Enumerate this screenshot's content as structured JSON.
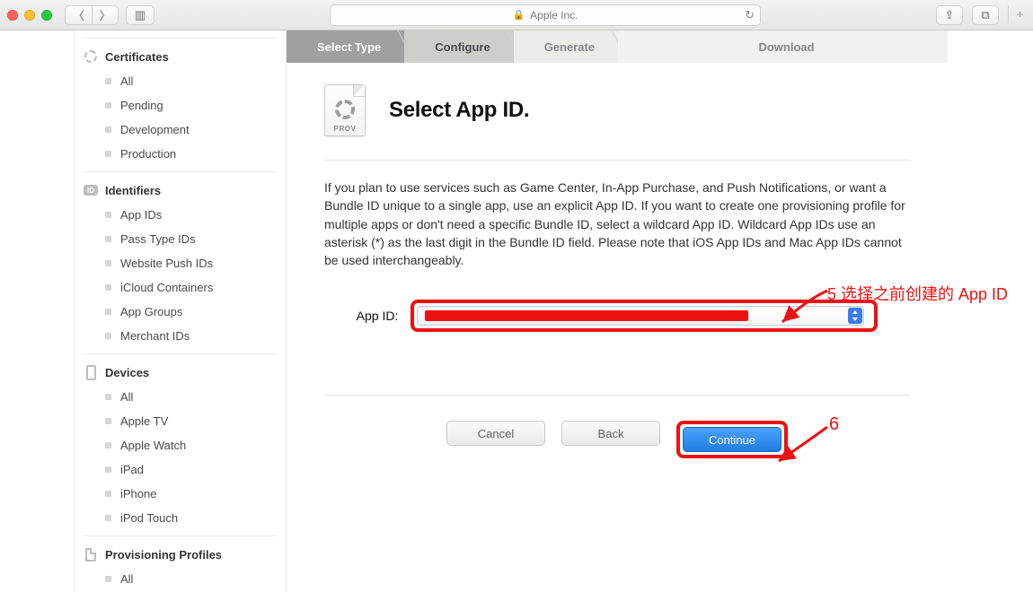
{
  "chrome": {
    "address_text": "Apple Inc.",
    "reload_glyph": "↻",
    "back_glyph": "〈",
    "fwd_glyph": "〉",
    "sidebar_glyph": "▥",
    "share_glyph": "⇪",
    "tabs_glyph": "⧉",
    "plus_glyph": "+"
  },
  "sidebar": {
    "sections": [
      {
        "title": "Certificates",
        "icon": "rosette",
        "items": [
          "All",
          "Pending",
          "Development",
          "Production"
        ]
      },
      {
        "title": "Identifiers",
        "icon": "id-chip",
        "items": [
          "App IDs",
          "Pass Type IDs",
          "Website Push IDs",
          "iCloud Containers",
          "App Groups",
          "Merchant IDs"
        ]
      },
      {
        "title": "Devices",
        "icon": "phone",
        "items": [
          "All",
          "Apple TV",
          "Apple Watch",
          "iPad",
          "iPhone",
          "iPod Touch"
        ]
      },
      {
        "title": "Provisioning Profiles",
        "icon": "doc",
        "items": [
          "All"
        ]
      }
    ]
  },
  "steps": {
    "s1": "Select Type",
    "s2": "Configure",
    "s3": "Generate",
    "s4": "Download"
  },
  "hero": {
    "prov_label": "PROV",
    "title": "Select App ID."
  },
  "desc": "If you plan to use services such as Game Center, In-App Purchase, and Push Notifications, or want a Bundle ID unique to a single app, use an explicit App ID. If you want to create one provisioning profile for multiple apps or don't need a specific Bundle ID, select a wildcard App ID. Wildcard App IDs use an asterisk (*) as the last digit in the Bundle ID field. Please note that iOS App IDs and Mac App IDs cannot be used interchangeably.",
  "form": {
    "label": "App ID:"
  },
  "buttons": {
    "cancel": "Cancel",
    "back": "Back",
    "continue": "Continue"
  },
  "annotations": {
    "five": "5 选择之前创建的 App ID",
    "six": "6"
  }
}
